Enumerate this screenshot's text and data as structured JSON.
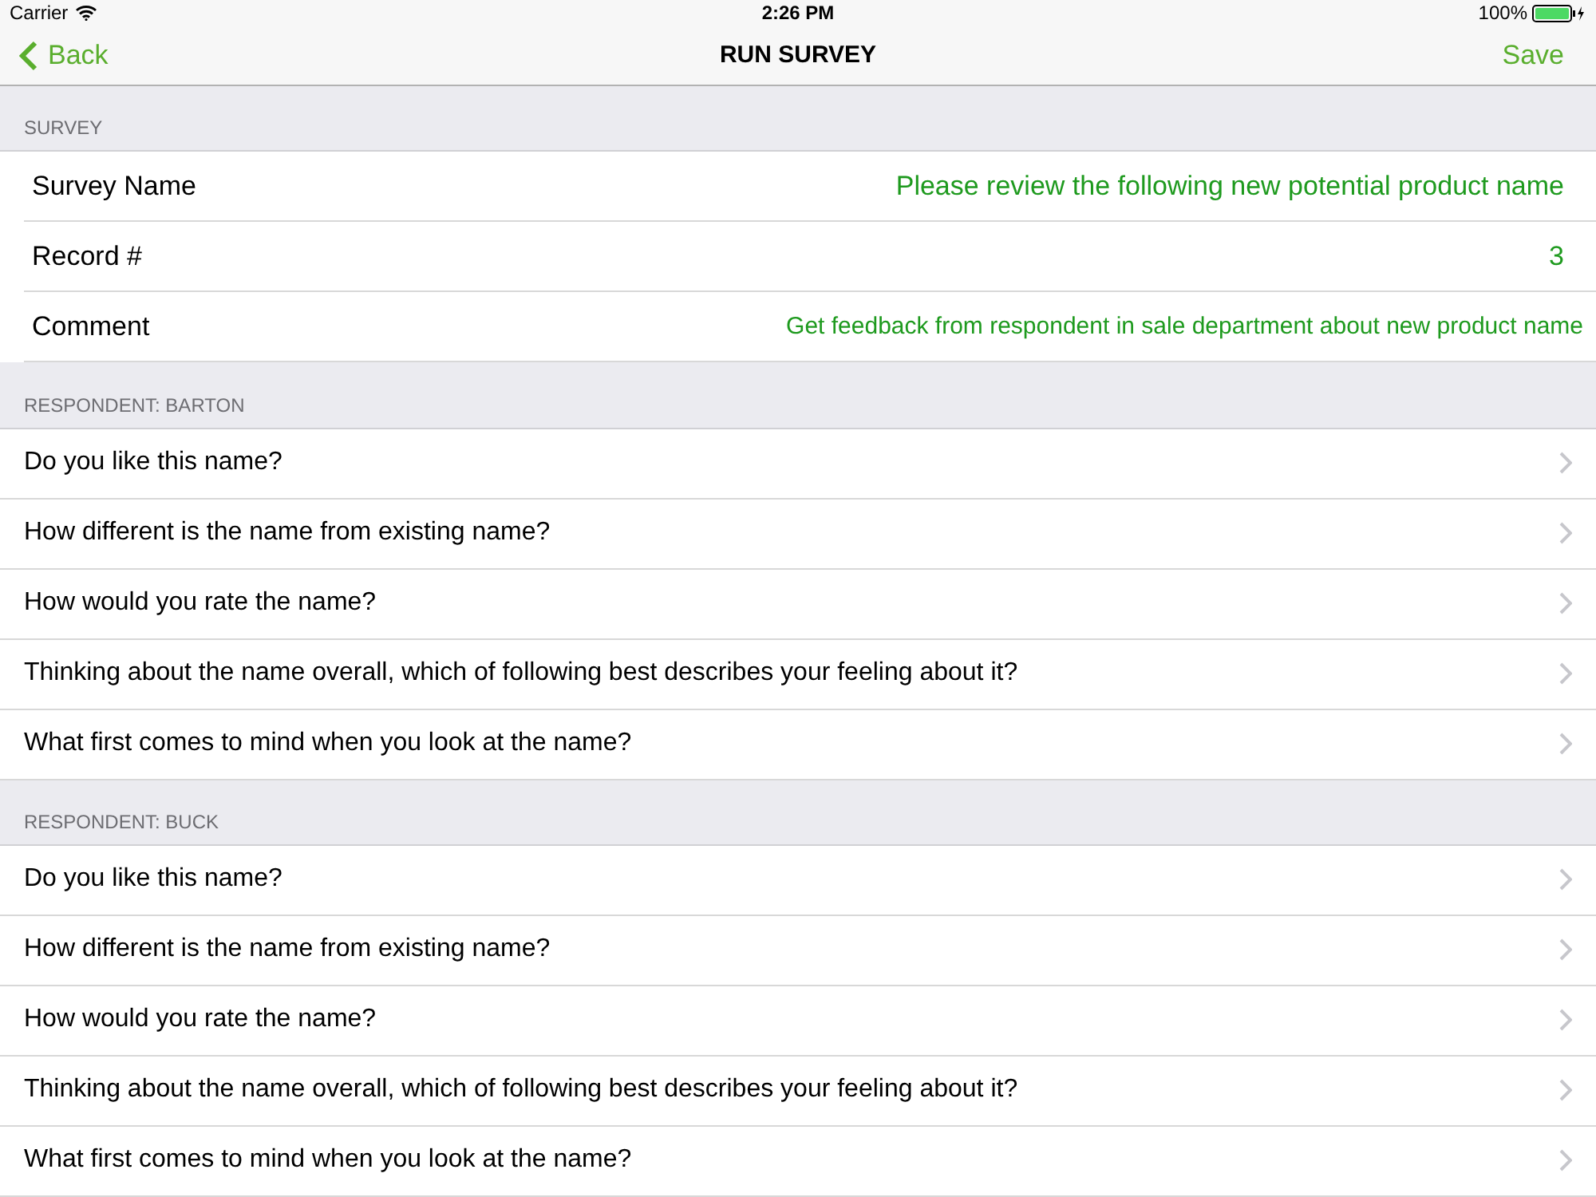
{
  "status_bar": {
    "carrier": "Carrier",
    "time": "2:26 PM",
    "battery": "100%"
  },
  "nav": {
    "back": "Back",
    "title": "RUN SURVEY",
    "action": "Save"
  },
  "survey": {
    "header": "SURVEY",
    "fields": [
      {
        "label": "Survey Name",
        "value": "Please review the following new potential product name"
      },
      {
        "label": "Record #",
        "value": "3"
      },
      {
        "label": "Comment",
        "value": "Get feedback from respondent in sale department about new product name"
      }
    ]
  },
  "respondents": [
    {
      "header": "RESPONDENT: BARTON",
      "questions": [
        "Do you like this name?",
        "How different is the name from existing name?",
        "How would you rate the name?",
        "Thinking about the name overall, which of following best describes your feeling about it?",
        "What first comes to mind when you look at the name?"
      ]
    },
    {
      "header": "RESPONDENT: BUCK",
      "questions": [
        "Do you like this name?",
        "How different is the name from existing name?",
        "How would you rate the name?",
        "Thinking about the name overall, which of following best describes your feeling about it?",
        "What first comes to mind when you look at the name?"
      ]
    }
  ]
}
